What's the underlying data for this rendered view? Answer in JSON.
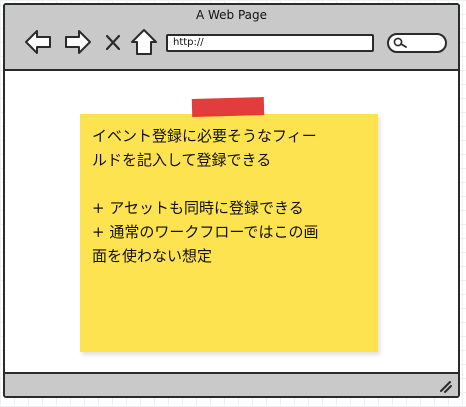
{
  "window": {
    "title": "A Web Page"
  },
  "toolbar": {
    "address_value": "http://",
    "icons": [
      "back-arrow-icon",
      "forward-arrow-icon",
      "close-x-icon",
      "home-icon",
      "search-icon"
    ]
  },
  "note": {
    "text": "イベント登録に必要そうなフィー\nルドを記入して登録できる\n\n+ アセットも同時に登録できる\n+ 通常のワークフローではこの画\n面を使わない想定",
    "color": "#fde34f",
    "tape_color": "#e02b2b"
  }
}
